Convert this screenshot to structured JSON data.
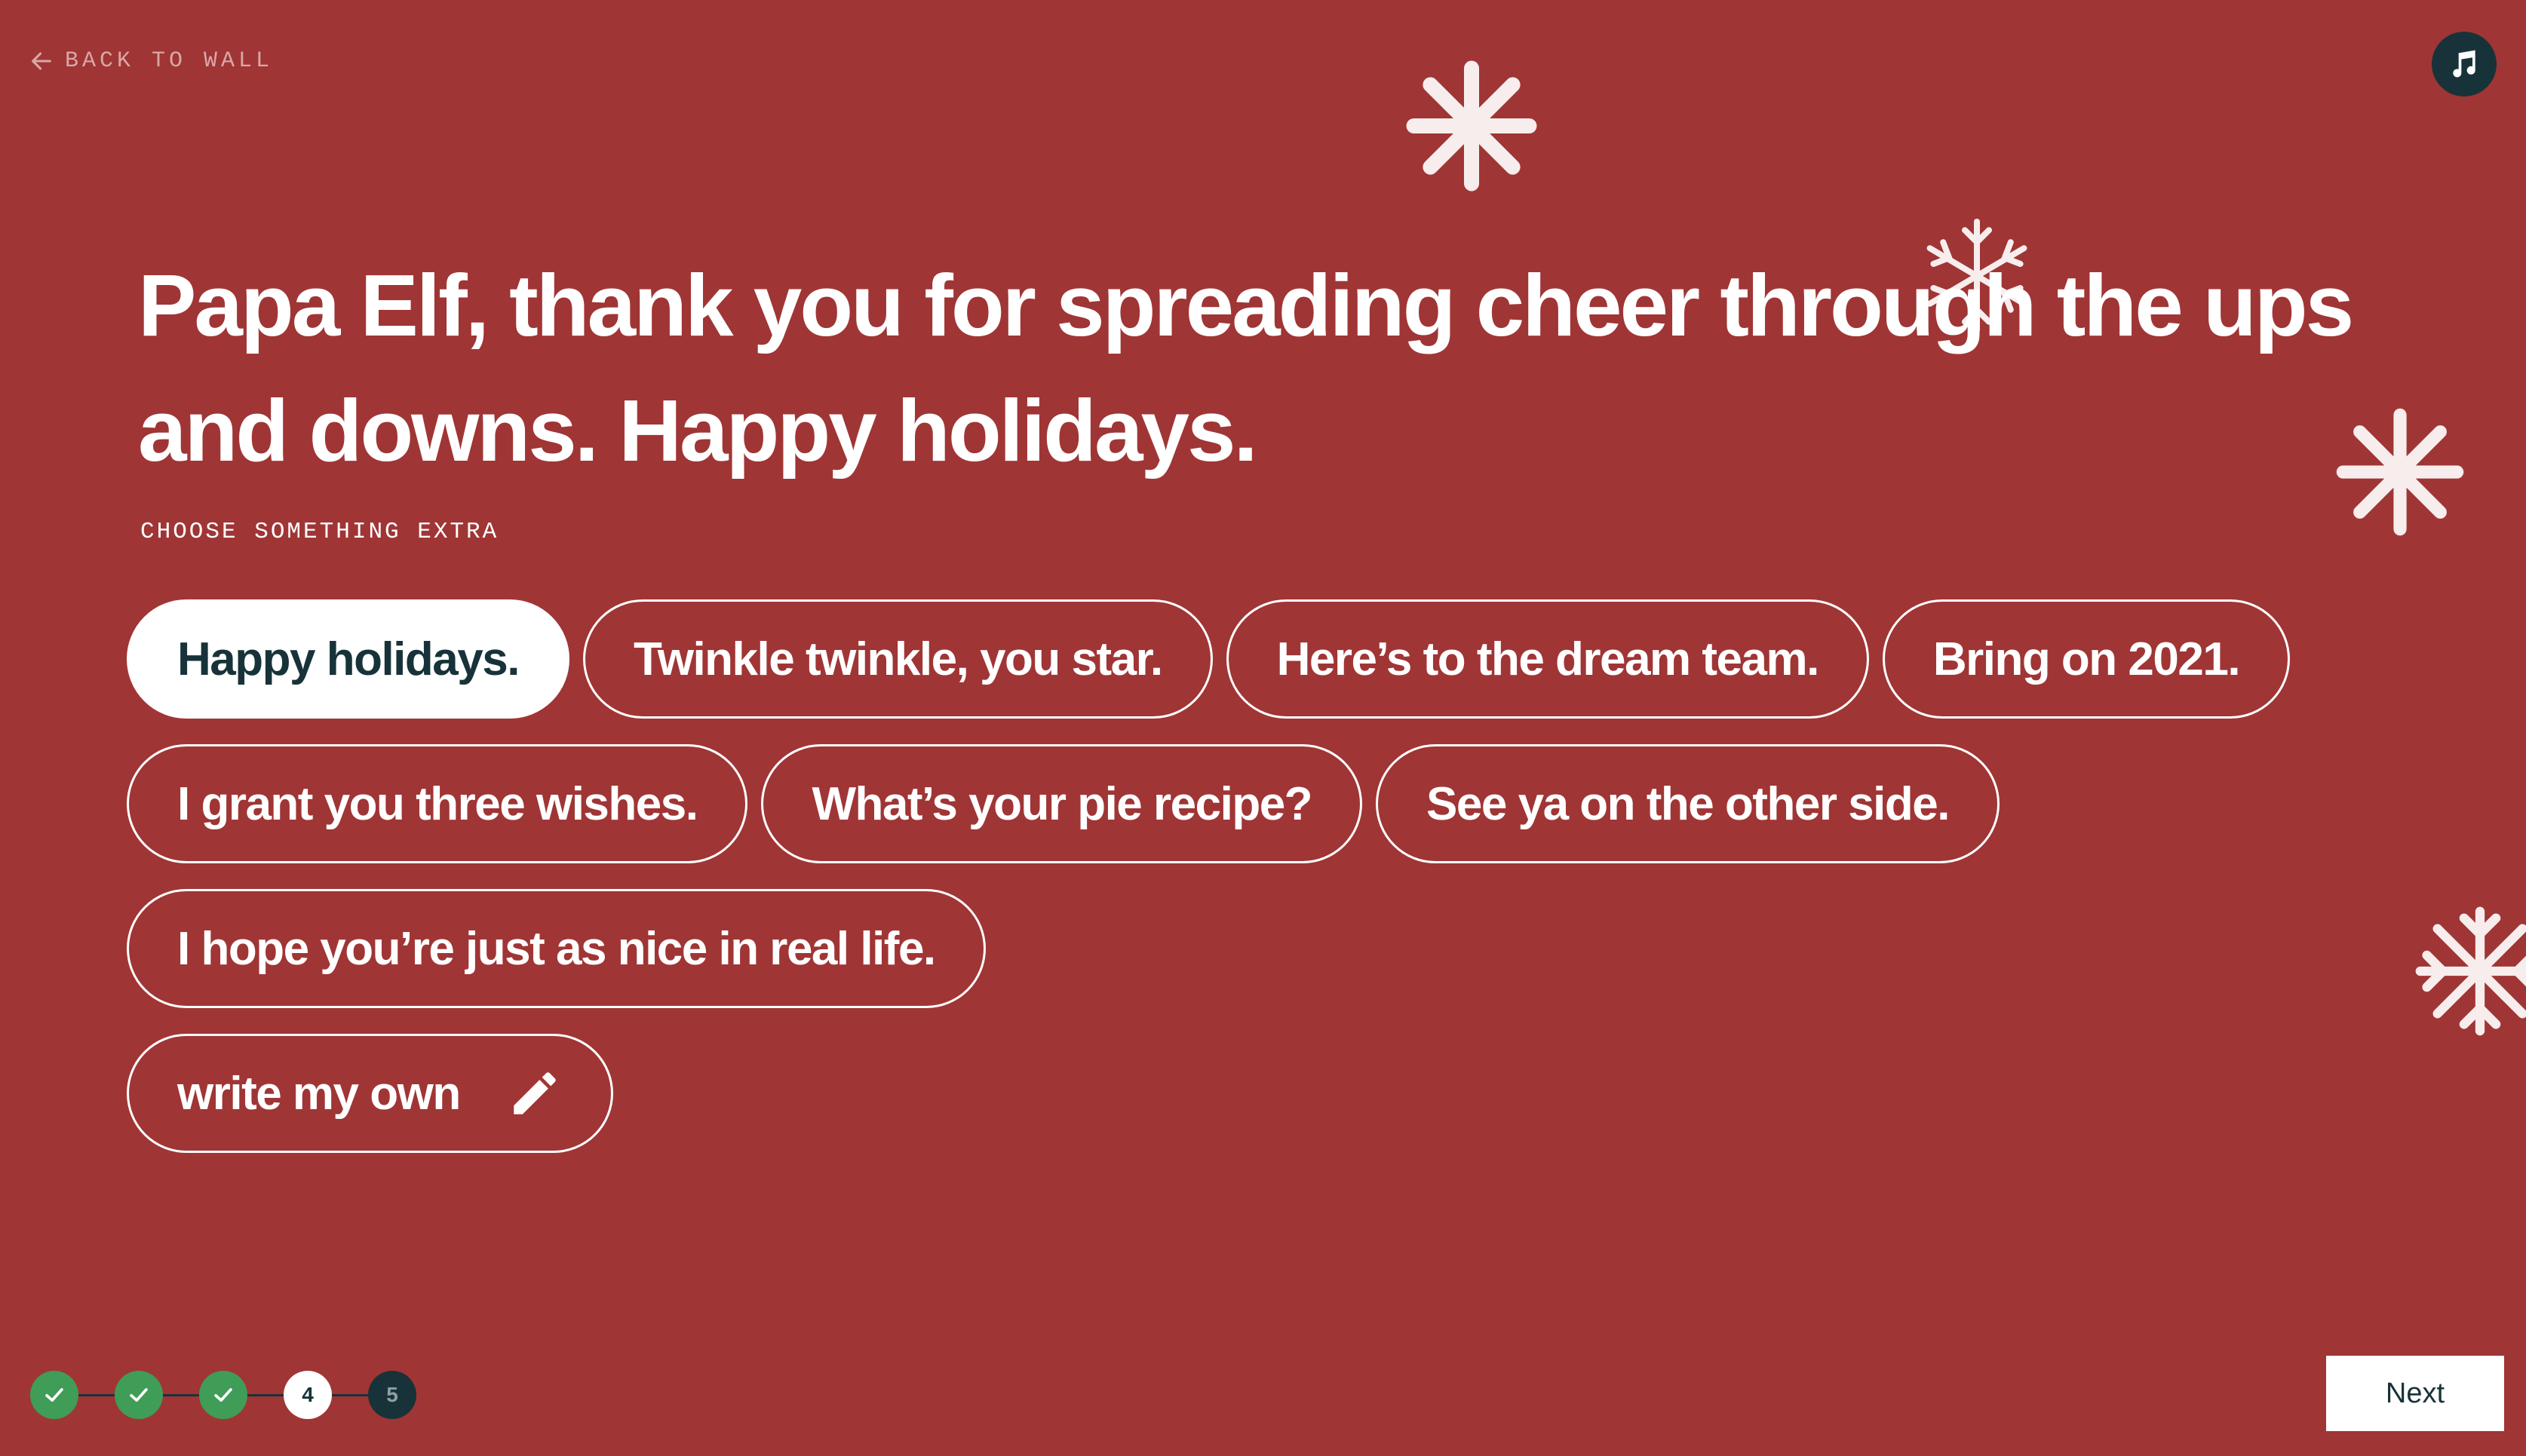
{
  "nav": {
    "back_label": "BACK TO WALL",
    "back_icon": "arrow-left-icon",
    "music_icon": "music-note-icon"
  },
  "message": {
    "headline": "Papa Elf, thank you for spreading cheer through the ups and downs. Happy holidays.",
    "section_label": "CHOOSE SOMETHING EXTRA"
  },
  "options": {
    "row1": [
      "Happy holidays.",
      "Twinkle twinkle, you star.",
      "Here’s to the dream team.",
      "Bring on 2021."
    ],
    "row2": [
      "I grant you three wishes.",
      "What’s your pie recipe?",
      "See ya on the other side."
    ],
    "row3": [
      "I hope you’re just as nice in real life."
    ],
    "selected": "Happy holidays.",
    "write_own_label": "write my own",
    "write_own_icon": "pencil-icon"
  },
  "progress": {
    "steps": [
      {
        "label": "",
        "state": "done"
      },
      {
        "label": "",
        "state": "done"
      },
      {
        "label": "",
        "state": "done"
      },
      {
        "label": "4",
        "state": "current"
      },
      {
        "label": "5",
        "state": "upcoming"
      }
    ],
    "current_step": 4,
    "total_steps": 5
  },
  "footer": {
    "next_label": "Next"
  },
  "colors": {
    "background": "#a03535",
    "dark": "#173339",
    "done_green": "#3f9d57",
    "white": "#ffffff"
  }
}
